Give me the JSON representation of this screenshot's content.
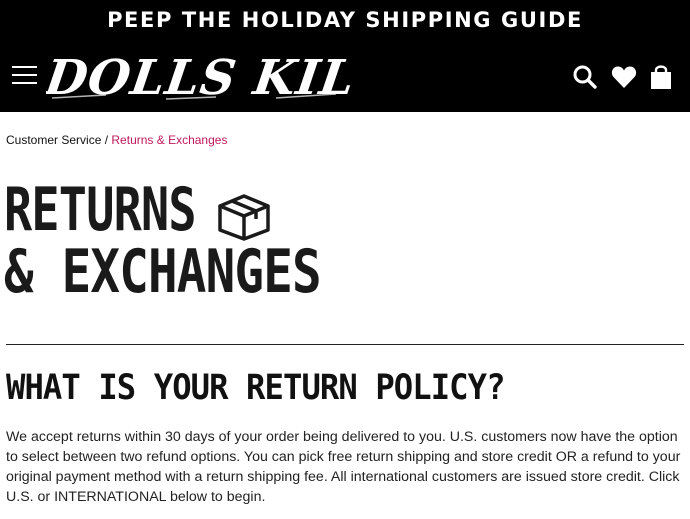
{
  "promo": {
    "text": "PEEP THE HOLIDAY SHIPPING GUIDE"
  },
  "header": {
    "logo_text": "DOLLS KILL",
    "icons": [
      "menu-icon",
      "search-icon",
      "heart-icon",
      "shopping-bag-icon"
    ]
  },
  "breadcrumb": {
    "parent": "Customer Service",
    "separator": " / ",
    "current": "Returns & Exchanges"
  },
  "page": {
    "title_line1": "RETURNS",
    "title_line2": "& EXCHANGES",
    "title_icon": "box-icon"
  },
  "section": {
    "heading": "WHAT IS YOUR RETURN POLICY?",
    "body": "We accept returns within 30 days of your order being delivered to you. U.S. customers now have the option to select between two refund options. You can pick free return shipping and store credit OR a refund to your original payment method with a return shipping fee. All international customers are issued store credit. Click U.S. or INTERNATIONAL below to begin."
  },
  "colors": {
    "header_bg": "#000000",
    "accent": "#c2185b",
    "text": "#111111"
  }
}
